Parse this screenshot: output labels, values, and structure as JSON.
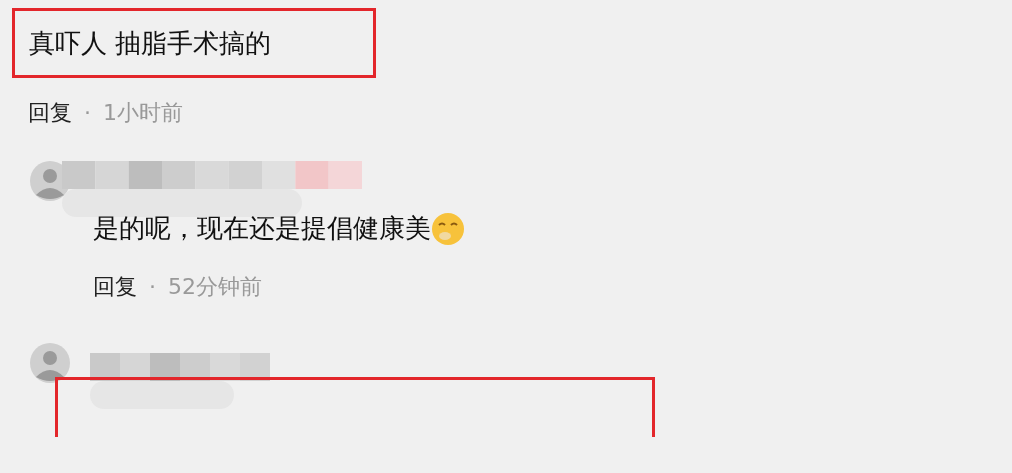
{
  "comment": {
    "text": "真吓人 抽脂手术搞的",
    "highlighted": true,
    "reply_label": "回复",
    "separator": "·",
    "time": "1小时前"
  },
  "replies": [
    {
      "text": "是的呢，现在还是提倡健康美",
      "reply_label": "回复",
      "separator": "·",
      "time": "52分钟前"
    }
  ],
  "next_comment": {
    "highlighted": true
  }
}
